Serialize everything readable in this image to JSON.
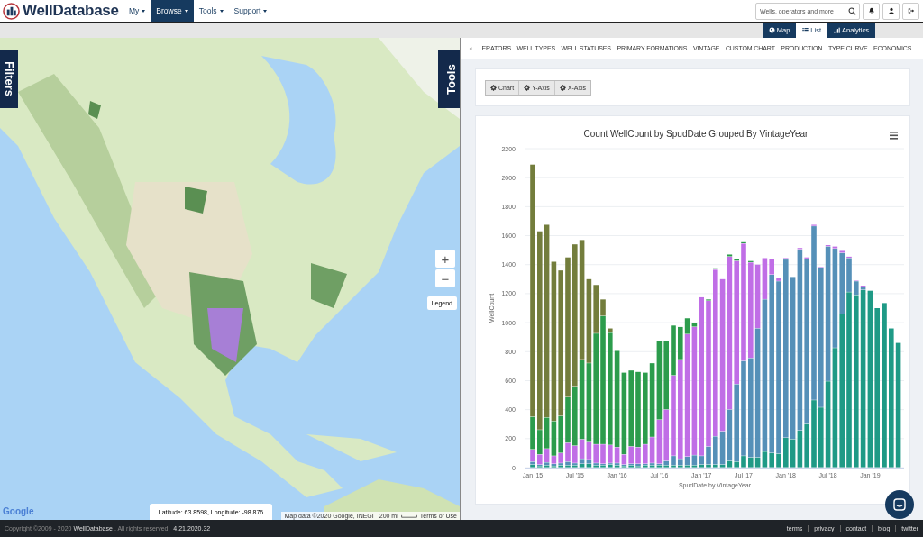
{
  "header": {
    "logo_text": "WellDatabase",
    "nav": [
      {
        "label": "My",
        "selected": false
      },
      {
        "label": "Browse",
        "selected": true
      },
      {
        "label": "Tools",
        "selected": false
      },
      {
        "label": "Support",
        "selected": false
      }
    ],
    "search": {
      "placeholder": "Wells, operators and more"
    }
  },
  "view_toggle": [
    {
      "label": "Map",
      "selected": true,
      "kind": "globe"
    },
    {
      "label": "List",
      "selected": false,
      "kind": "list"
    },
    {
      "label": "Analytics",
      "selected": true,
      "kind": "chart"
    }
  ],
  "map": {
    "filters_tab": "Filters",
    "tools_tab": "Tools",
    "zoom_in": "+",
    "zoom_out": "−",
    "legend_button": "Legend",
    "coordinates": "Latitude: 63.8598, Longitude: -98.876",
    "google_text": "Google",
    "attribution": "Map data ©2020 Google, INEGI",
    "scale": "200 mi",
    "terms": "Terms of Use"
  },
  "analytics": {
    "tabs": [
      {
        "label": "ERATORS",
        "selected": false
      },
      {
        "label": "WELL TYPES",
        "selected": false
      },
      {
        "label": "WELL STATUSES",
        "selected": false
      },
      {
        "label": "PRIMARY FORMATIONS",
        "selected": false
      },
      {
        "label": "VINTAGE",
        "selected": false
      },
      {
        "label": "CUSTOM CHART",
        "selected": true
      },
      {
        "label": "PRODUCTION",
        "selected": false
      },
      {
        "label": "TYPE CURVE",
        "selected": false
      },
      {
        "label": "ECONOMICS",
        "selected": false
      }
    ],
    "chart_buttons": [
      "Chart",
      "Y-Axis",
      "X-Axis"
    ],
    "chart_data": {
      "type": "bar",
      "title": "Count WellCount by SpudDate Grouped By VintageYear",
      "xlabel": "SpudDate by VintageYear",
      "ylabel": "WellCount",
      "stacked": true,
      "grid": true,
      "ylim": [
        0,
        2200
      ],
      "yticks": [
        0,
        200,
        400,
        600,
        800,
        1000,
        1200,
        1400,
        1600,
        1800,
        2000,
        2200
      ],
      "categories": [
        "Jan '15",
        null,
        null,
        null,
        null,
        null,
        "Jul '15",
        null,
        null,
        null,
        null,
        null,
        "Jan '16",
        null,
        null,
        null,
        null,
        null,
        "Jul '16",
        null,
        null,
        null,
        null,
        null,
        "Jan '17",
        null,
        null,
        null,
        null,
        null,
        "Jul '17",
        null,
        null,
        null,
        null,
        null,
        "Jan '18",
        null,
        null,
        null,
        null,
        null,
        "Jul '18",
        null,
        null,
        null,
        null,
        null,
        "Jan '19",
        null,
        null,
        null,
        null
      ],
      "series": [
        {
          "color": "#1f9a86",
          "values": [
            20,
            10,
            15,
            10,
            15,
            15,
            15,
            25,
            25,
            15,
            15,
            20,
            15,
            10,
            15,
            10,
            15,
            15,
            15,
            15,
            15,
            15,
            15,
            15,
            20,
            20,
            20,
            20,
            45,
            40,
            80,
            70,
            70,
            110,
            100,
            95,
            205,
            195,
            255,
            300,
            465,
            415,
            595,
            825,
            1060,
            1210,
            1190,
            1225,
            1220,
            1100,
            1135,
            960,
            860
          ]
        },
        {
          "color": "#5590b8",
          "values": [
            20,
            10,
            20,
            15,
            15,
            25,
            15,
            35,
            30,
            15,
            10,
            10,
            15,
            10,
            10,
            15,
            10,
            15,
            10,
            30,
            65,
            45,
            60,
            70,
            60,
            125,
            195,
            230,
            355,
            535,
            655,
            685,
            890,
            1050,
            1230,
            1190,
            1230,
            1120,
            1250,
            1140,
            1200,
            965,
            930,
            685,
            420,
            235,
            95,
            20,
            0,
            0,
            0,
            null,
            0
          ]
        },
        {
          "color": "#c06ee6",
          "values": [
            85,
            70,
            95,
            55,
            70,
            130,
            120,
            135,
            120,
            130,
            135,
            125,
            110,
            70,
            120,
            115,
            135,
            180,
            305,
            355,
            555,
            685,
            845,
            885,
            1095,
            1005,
            1150,
            1050,
            1055,
            850,
            810,
            660,
            440,
            285,
            110,
            20,
            10,
            null,
            10,
            10,
            10,
            5,
            10,
            15,
            15,
            10,
            5,
            10,
            0,
            0,
            0,
            0,
            0
          ]
        },
        {
          "color": "#2c9c4c",
          "values": [
            225,
            170,
            215,
            240,
            255,
            315,
            410,
            550,
            545,
            765,
            885,
            775,
            665,
            565,
            525,
            520,
            495,
            510,
            545,
            470,
            345,
            225,
            110,
            30,
            0,
            10,
            10,
            0,
            15,
            15,
            10,
            10,
            0,
            0,
            0,
            0,
            0,
            0,
            0,
            0,
            0,
            0,
            0,
            0,
            0,
            0,
            0,
            0,
            0,
            0,
            0,
            0,
            0
          ]
        },
        {
          "color": "#737d3c",
          "values": [
            1740,
            1370,
            1330,
            1100,
            1005,
            965,
            980,
            825,
            580,
            335,
            115,
            30,
            0,
            0,
            0,
            0,
            0,
            0,
            0,
            0,
            0,
            0,
            0,
            0,
            0,
            0,
            0,
            0,
            0,
            0,
            0,
            0,
            0,
            0,
            0,
            0,
            0,
            0,
            0,
            0,
            0,
            0,
            0,
            0,
            0,
            0,
            0,
            0,
            0,
            0,
            0,
            0,
            0
          ]
        }
      ]
    }
  },
  "footer": {
    "copyright_lead": "Copyright ©2009 - 2020",
    "brand": "WellDatabase",
    "rights": ". All rights reserved.",
    "version": "4.21.2020.32",
    "links": [
      "terms",
      "privacy",
      "contact",
      "blog",
      "twitter"
    ]
  }
}
